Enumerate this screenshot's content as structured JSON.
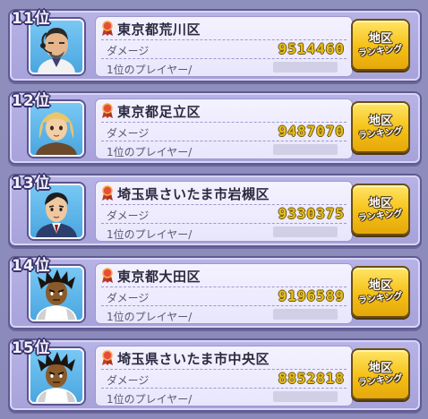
{
  "rows": [
    {
      "rank": "11位",
      "prefecture_area": "東京都荒川区",
      "damage_label": "ダメージ",
      "damage": "9514460",
      "first_player_label": "1位のプレイヤー/",
      "button_line1": "地区",
      "button_line2": "ランキング",
      "avatar": "man-headset"
    },
    {
      "rank": "12位",
      "prefecture_area": "東京都足立区",
      "damage_label": "ダメージ",
      "damage": "9487070",
      "first_player_label": "1位のプレイヤー/",
      "button_line1": "地区",
      "button_line2": "ランキング",
      "avatar": "blonde-woman"
    },
    {
      "rank": "13位",
      "prefecture_area": "埼玉県さいたま市岩槻区",
      "damage_label": "ダメージ",
      "damage": "9330375",
      "first_player_label": "1位のプレイヤー/",
      "button_line1": "地区",
      "button_line2": "ランキング",
      "avatar": "man-suit"
    },
    {
      "rank": "14位",
      "prefecture_area": "東京都大田区",
      "damage_label": "ダメージ",
      "damage": "9196589",
      "first_player_label": "1位のプレイヤー/",
      "button_line1": "地区",
      "button_line2": "ランキング",
      "avatar": "spiky-hair-boy"
    },
    {
      "rank": "15位",
      "prefecture_area": "埼玉県さいたま市中央区",
      "damage_label": "ダメージ",
      "damage": "8852818",
      "first_player_label": "1位のプレイヤー/",
      "button_line1": "地区",
      "button_line2": "ランキング",
      "avatar": "spiky-hair-boy"
    }
  ]
}
